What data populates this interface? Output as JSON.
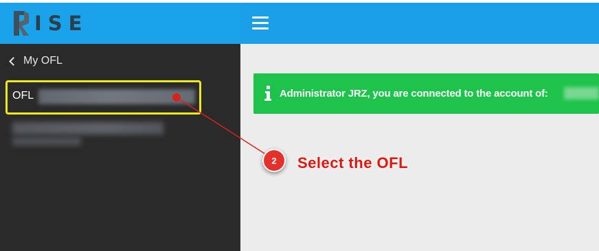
{
  "header": {
    "logo_text": "ISE",
    "menu_icon": "hamburger-icon",
    "brand_color": "#1aa3ea"
  },
  "sidebar": {
    "back_label": "My OFL",
    "back_icon": "chevron-left-icon",
    "items": [
      {
        "label": "OFL"
      }
    ]
  },
  "alert": {
    "icon": "info-icon",
    "message": "Administrator JRZ, you are connected to the account of:",
    "color": "#1dc34a"
  },
  "annotation": {
    "step_number": "2",
    "step_text": "Select the OFL",
    "color": "#e4312b",
    "highlight_color": "#f1ea11"
  }
}
